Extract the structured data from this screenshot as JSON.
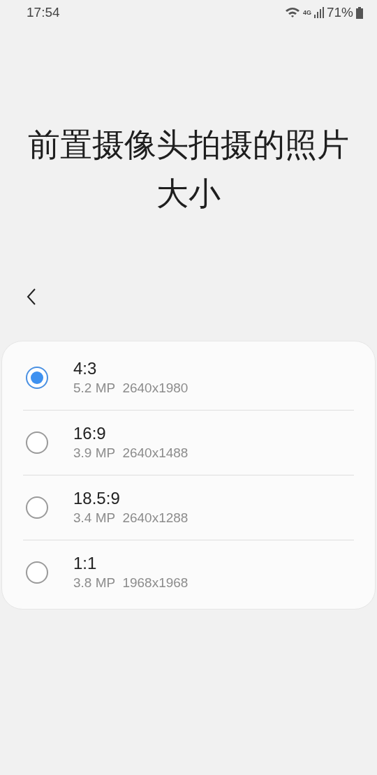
{
  "status_bar": {
    "time": "17:54",
    "network": "4G",
    "battery": "71%"
  },
  "title": "前置摄像头拍摄的照片大小",
  "options": [
    {
      "label": "4:3",
      "detail": "5.2 MP  2640x1980",
      "selected": true
    },
    {
      "label": "16:9",
      "detail": "3.9 MP  2640x1488",
      "selected": false
    },
    {
      "label": "18.5:9",
      "detail": "3.4 MP  2640x1288",
      "selected": false
    },
    {
      "label": "1:1",
      "detail": "3.8 MP  1968x1968",
      "selected": false
    }
  ]
}
